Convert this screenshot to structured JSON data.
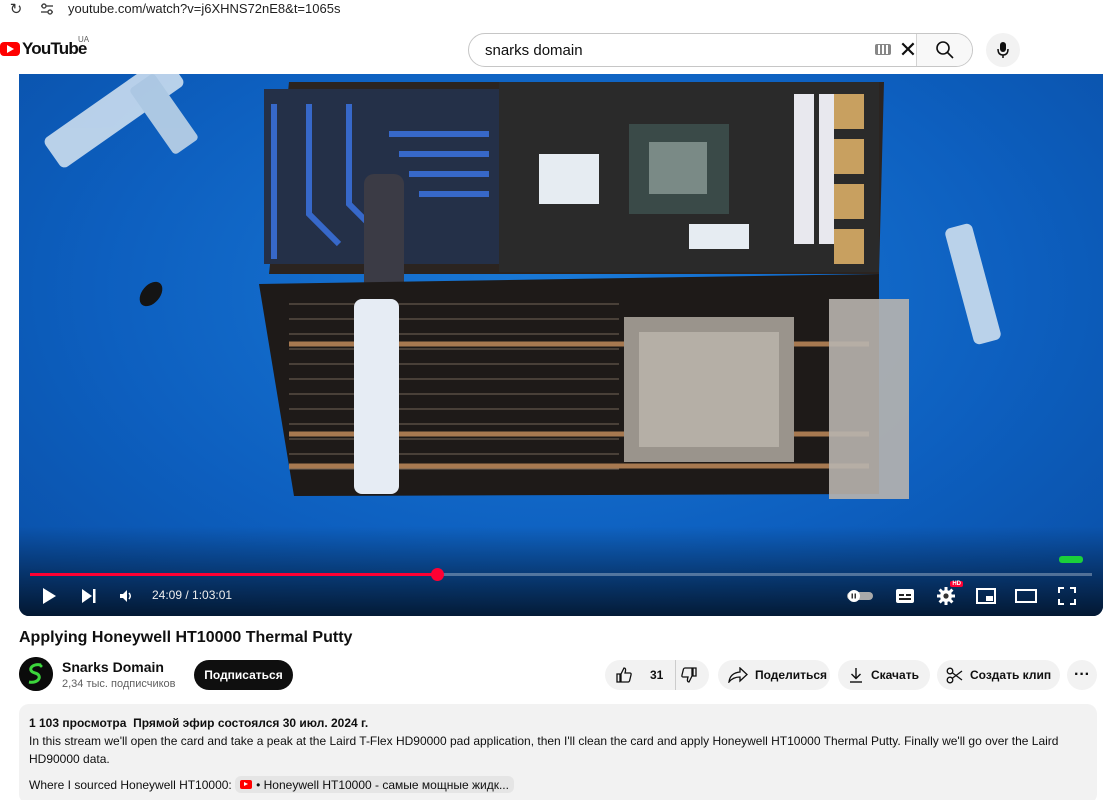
{
  "browser": {
    "url": "youtube.com/watch?v=j6XHNS72nE8&t=1065s"
  },
  "masthead": {
    "logo_text": "YouTube",
    "region": "UA",
    "search_value": "snarks domain"
  },
  "player": {
    "current_time": "24:09",
    "duration": "1:03:01",
    "time_display": "24:09 / 1:03:01",
    "progress_fraction": 0.383,
    "hd_badge": "HD",
    "accent_color": "#ff0033"
  },
  "video": {
    "title": "Applying Honeywell HT10000 Thermal Putty",
    "channel_name": "Snarks Domain",
    "subscribers": "2,34 тыс. подписчиков",
    "subscribe_label": "Подписаться",
    "likes": "31",
    "share_label": "Поделиться",
    "download_label": "Скачать",
    "clip_label": "Создать клип",
    "more_label": "···"
  },
  "description": {
    "views": "1 103 просмотра",
    "live_info": "Прямой эфир состоялся 30 июл. 2024 г.",
    "text": "In this stream we'll open the card and take a peak at the Laird T-Flex HD90000 pad application, then I'll clean the card and apply Honeywell HT10000 Thermal Putty. Finally we'll go over the Laird HD90000 data.",
    "source_prefix": "Where I sourced Honeywell HT10000:",
    "source_link": "• Honeywell HT10000 - самые мощные жидк..."
  },
  "icons": {
    "reload": "reload-icon",
    "site_settings": "tune-icon",
    "search": "search-icon",
    "mic": "mic-icon",
    "play": "play-icon",
    "next": "next-icon",
    "volume": "volume-icon",
    "autoplay": "autoplay-toggle-icon",
    "subtitles": "subtitles-icon",
    "settings": "gear-icon",
    "miniplayer": "miniplayer-icon",
    "theater": "theater-icon",
    "fullscreen": "fullscreen-icon",
    "like": "thumb-up-icon",
    "dislike": "thumb-down-icon",
    "share": "share-icon",
    "download": "download-icon",
    "clip": "scissors-icon"
  }
}
